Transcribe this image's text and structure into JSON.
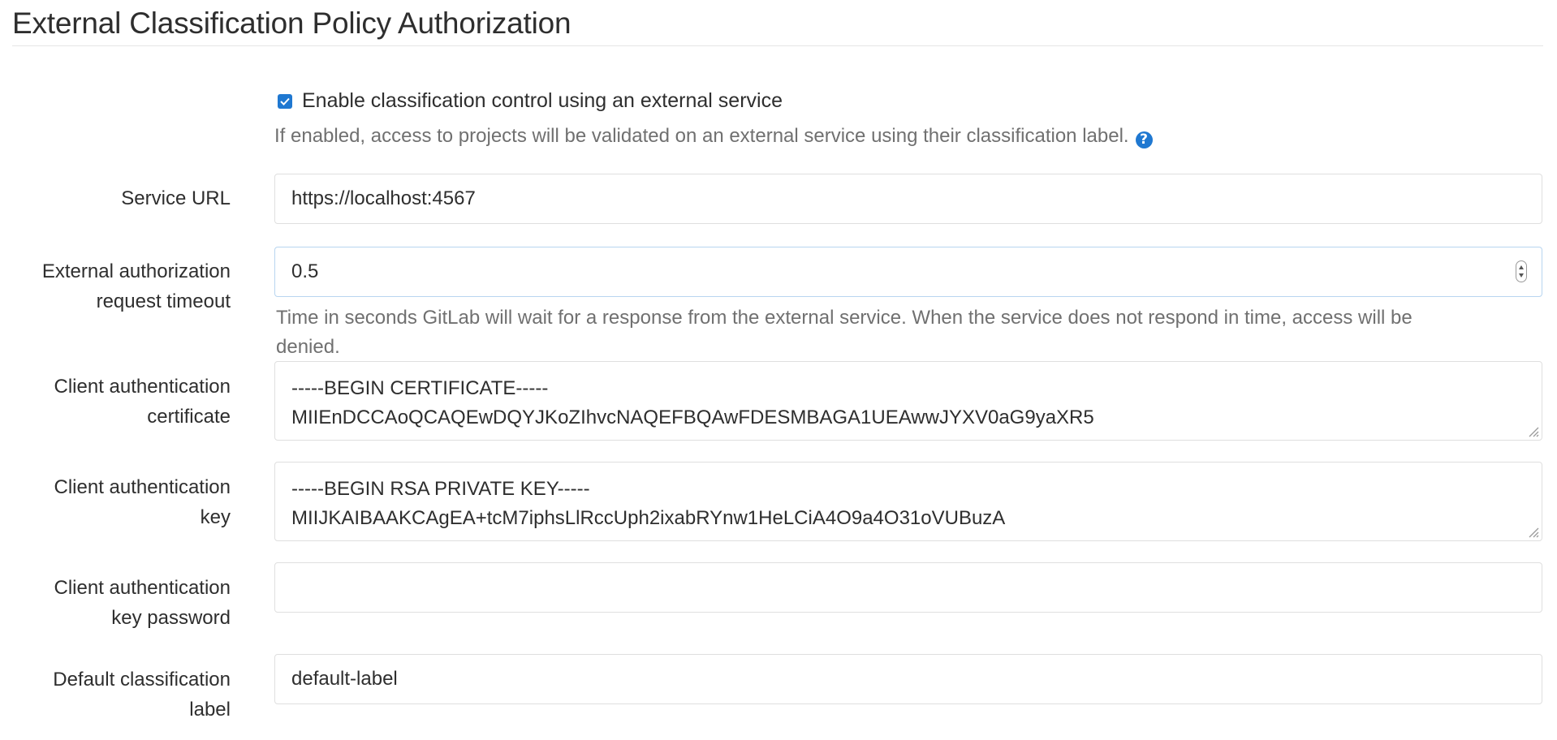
{
  "page": {
    "title": "External Classification Policy Authorization"
  },
  "enable": {
    "checked": true,
    "label": "Enable classification control using an external service",
    "help": "If enabled, access to projects will be validated on an external service using their classification label.",
    "help_icon": "question-circle-icon"
  },
  "service_url": {
    "label": "Service URL",
    "value": "https://localhost:4567"
  },
  "timeout": {
    "label_line1": "External authorization",
    "label_line2": "request timeout",
    "value": "0.5",
    "help_line1": "Time in seconds GitLab will wait for a response from the external service. When the service does not respond in time, access will be",
    "help_line2": "denied."
  },
  "certificate": {
    "label_line1": "Client authentication",
    "label_line2": "certificate",
    "line1": "-----BEGIN CERTIFICATE-----",
    "line2": "MIIEnDCCAoQCAQEwDQYJKoZIhvcNAQEFBQAwFDESMBAGA1UEAwwJYXV0aG9yaXR5"
  },
  "key": {
    "label_line1": "Client authentication",
    "label_line2": "key",
    "line1": "-----BEGIN RSA PRIVATE KEY-----",
    "line2": "MIIJKAIBAAKCAgEA+tcM7iphsLlRccUph2ixabRYnw1HeLCiA4O9a4O31oVUBuzA"
  },
  "key_password": {
    "label_line1": "Client authentication",
    "label_line2": "key password",
    "value": ""
  },
  "default_label": {
    "label_line1": "Default classification",
    "label_line2": "label",
    "value": "default-label"
  },
  "colors": {
    "accent": "#1f78d1",
    "help_text": "#707070",
    "border": "#dfdfdf"
  }
}
